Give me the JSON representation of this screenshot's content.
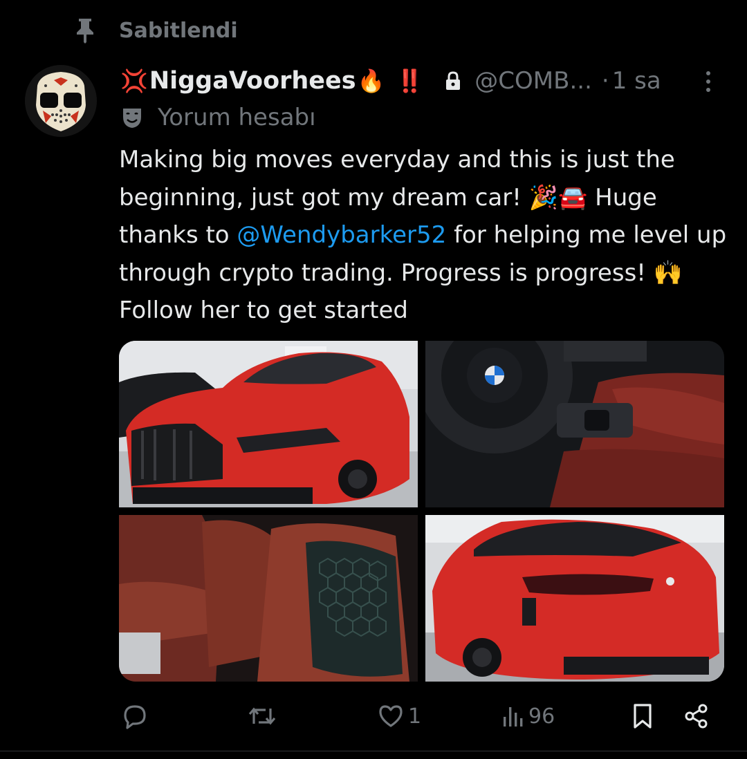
{
  "pinned": {
    "label": "Sabitlendi",
    "icon": "pin-icon"
  },
  "author": {
    "avatar_icon": "hockey-mask-avatar",
    "display_name": "NiggaVoorhees",
    "name_prefix_emoji": "💢",
    "name_suffix_emoji": "🔥",
    "name_suffix_mark": "‼️",
    "protected_icon": "lock-icon",
    "handle": "@COMB...",
    "separator": "·",
    "time": "1 sa",
    "more_icon": "more-vertical-icon",
    "account_label_icon": "theater-mask-icon",
    "account_label": "Yorum hesabı"
  },
  "post": {
    "text_before_mention": "Making big moves everyday and this is just the beginning, just got my dream car! 🎉🚘 Huge thanks to ",
    "mention": "@Wendybarker52",
    "text_after_mention": " for helping me level up through crypto trading. Progress is progress! 🙌 Follow her to get started",
    "media": [
      {
        "description_icon": "red-suv-front-photo"
      },
      {
        "description_icon": "steering-wheel-interior-photo"
      },
      {
        "description_icon": "red-leather-seats-photo"
      },
      {
        "description_icon": "red-suv-rear-photo"
      }
    ]
  },
  "actions": {
    "reply": {
      "icon": "reply-icon",
      "count": ""
    },
    "repost": {
      "icon": "repost-icon",
      "count": ""
    },
    "like": {
      "icon": "heart-icon",
      "count": "1"
    },
    "views": {
      "icon": "views-icon",
      "count": "96"
    },
    "bookmark": {
      "icon": "bookmark-icon"
    },
    "share": {
      "icon": "share-icon"
    }
  },
  "colors": {
    "background": "#000000",
    "text": "#e7e9ea",
    "secondary": "#71767b",
    "link": "#1d9bf0",
    "name_mark_red": "#e0245e"
  }
}
